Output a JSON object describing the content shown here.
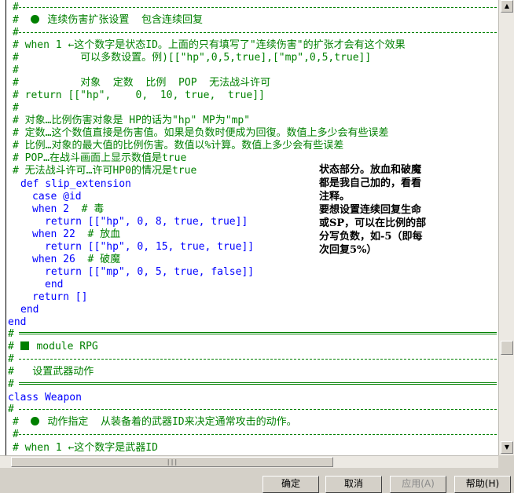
{
  "editor": {
    "lines": {
      "l1": "#-----------------------------------------------------------------------",
      "l2_title": "连续伤害扩张设置  包含连续回复",
      "l4": "# when 1 ←这个数字是状态ID。上面的只有填写了\"连续伤害\"的扩张才会有这个效果",
      "l5": "#          可以多数设置。例)[[\"hp\",0,5,true],[\"mp\",0,5,true]]",
      "l6": "#",
      "l7": "#          对象  定数  比例  POP  无法战斗许可",
      "l8": "# return [[\"hp\",    0,  10, true,  true]]",
      "l9": "#",
      "l10": "# 对象…比例伤害对象是 HP的话为\"hp\" MP为\"mp\"",
      "l11": "# 定数…这个数值直接是伤害值。如果是负数时便成为回復。数值上多少会有些误差",
      "l12": "# 比例…对象的最大值的比例伤害。数值以%计算。数值上多少会有些误差",
      "l13": "# POP…在战斗画面上显示数值是true",
      "l14": "# 无法战斗许可…许可HP0的情况是true",
      "l15": "def slip_extension",
      "l16": "case @id",
      "l17_a": "when 2",
      "l17_b": "# 毒",
      "l18": "return [[\"hp\", 0, 8, true, true]]",
      "l19_a": "when 22",
      "l19_b": "# 放血",
      "l20": "return [[\"hp\", 0, 15, true, true]]",
      "l21_a": "when 26",
      "l21_b": "# 破魔",
      "l22": "return [[\"mp\", 0, 5, true, false]]",
      "l23": "end",
      "l24": "return []",
      "l25": "end",
      "l26": "end",
      "l28_title": "module RPG",
      "l30": "#   设置武器动作",
      "l32": "class Weapon",
      "l34_title": "动作指定  从装备着的武器ID来决定通常攻击的动作。",
      "l36": "# when 1 ←这个数字是武器ID",
      "hash": "#",
      "hashes": "#",
      "hash_end": "#"
    }
  },
  "note": {
    "lines": [
      "状态部分。放血和破魔",
      "都是我自己加的，看看",
      "注释。",
      "要想设置连续回复生命",
      "或SP，可以在比例的部",
      "分写负数，如-5（即每",
      "次回复5%）"
    ]
  },
  "scrollbar": {
    "hthumb_grip": "|||"
  },
  "dialog": {
    "ok": "确定",
    "cancel": "取消",
    "apply": "应用(A)",
    "help": "帮助(H)"
  },
  "colors": {
    "comment": "#008000",
    "keyword": "#0000ff",
    "number": "#800000",
    "string": "#800080"
  }
}
